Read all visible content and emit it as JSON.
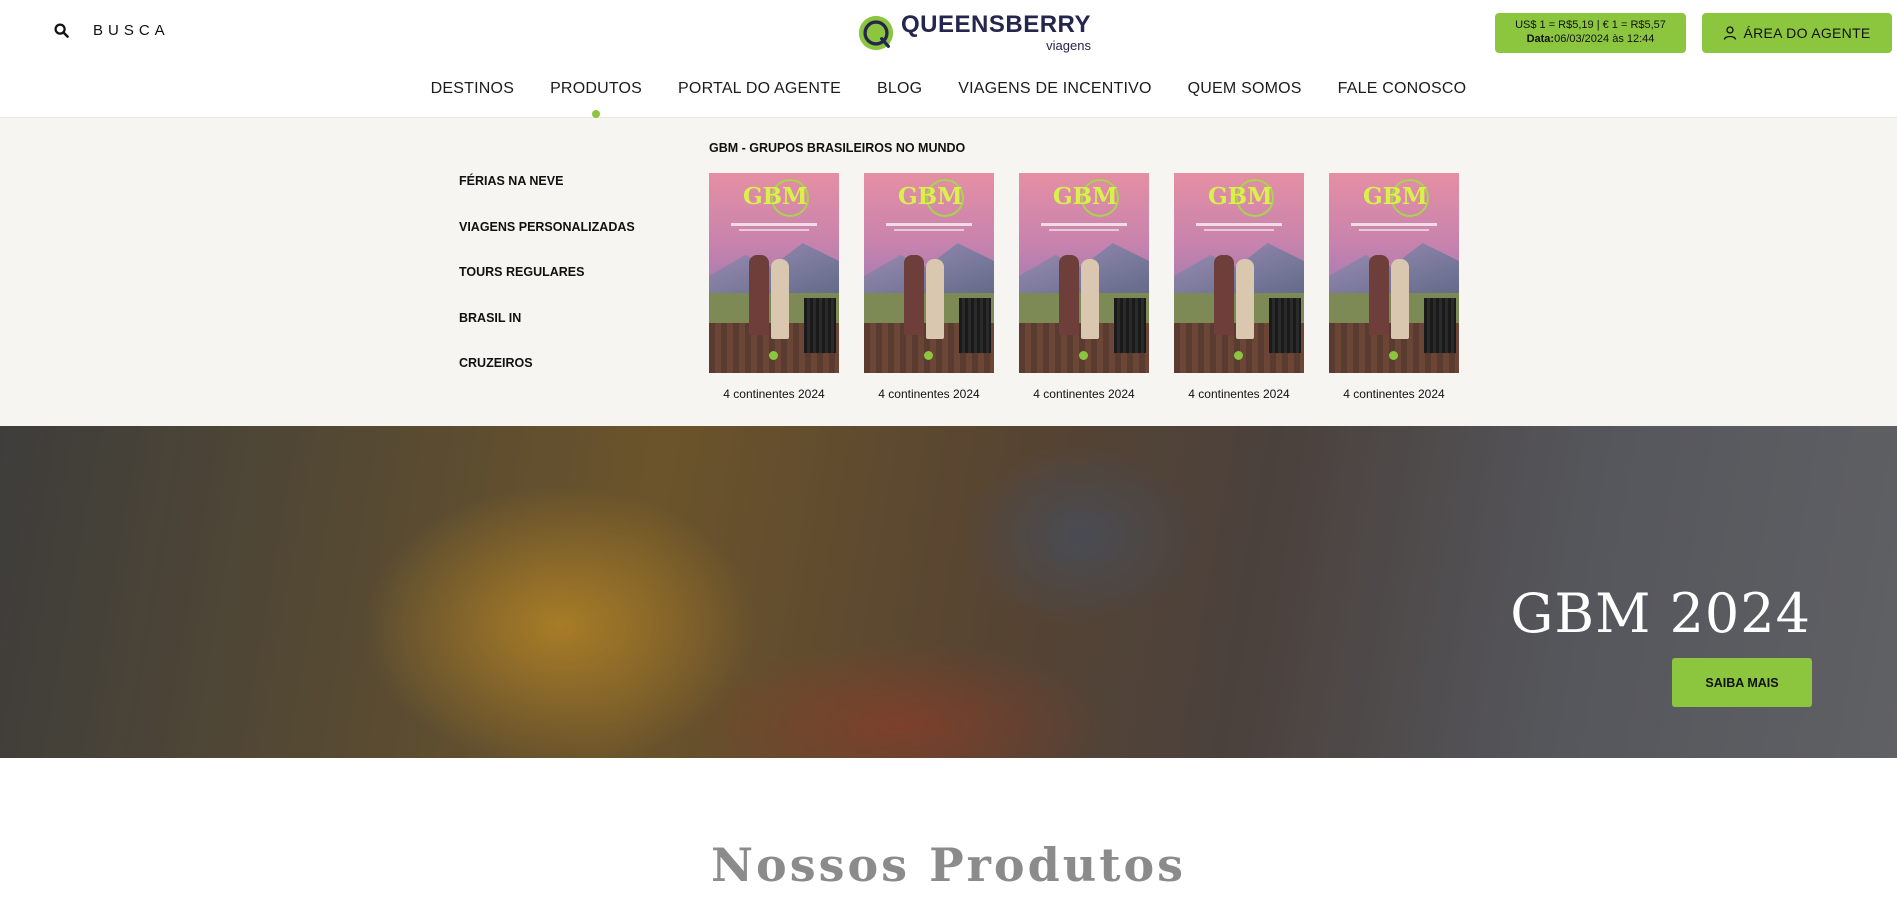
{
  "header": {
    "search_label": "BUSCA",
    "logo": {
      "name": "QUEENSBERRY",
      "sub": "viagens"
    },
    "exchange": {
      "rates": "US$ 1 = R$5,19 | € 1 = R$5,57",
      "date_label": "Data:",
      "date_value": "06/03/2024 às 12:44"
    },
    "agent_button": "ÁREA DO AGENTE",
    "nav": [
      {
        "label": "DESTINOS"
      },
      {
        "label": "PRODUTOS",
        "active": true
      },
      {
        "label": "PORTAL DO AGENTE"
      },
      {
        "label": "BLOG"
      },
      {
        "label": "VIAGENS DE INCENTIVO"
      },
      {
        "label": "QUEM SOMOS"
      },
      {
        "label": "FALE CONOSCO"
      }
    ]
  },
  "mega_menu": {
    "submenu": [
      "FÉRIAS NA NEVE",
      "VIAGENS PERSONALIZADAS",
      "TOURS REGULARES",
      "BRASIL IN",
      "CRUZEIROS"
    ],
    "catalog_title": "GBM - GRUPOS BRASILEIROS NO MUNDO",
    "catalogs": [
      {
        "caption": "4 continentes 2024",
        "cover_text": "GBM"
      },
      {
        "caption": "4 continentes 2024",
        "cover_text": "GBM"
      },
      {
        "caption": "4 continentes 2024",
        "cover_text": "GBM"
      },
      {
        "caption": "4 continentes 2024",
        "cover_text": "GBM"
      },
      {
        "caption": "4 continentes 2024",
        "cover_text": "GBM"
      }
    ]
  },
  "hero": {
    "title": "GBM 2024",
    "button": "SAIBA MAIS"
  },
  "section": {
    "title": "Nossos Produtos"
  },
  "colors": {
    "accent": "#8cc63f",
    "brand": "#25264d",
    "menu_bg": "#f6f5f2"
  },
  "icons": {
    "search": "search-icon",
    "user": "user-icon",
    "logo": "queensberry-logo-icon"
  }
}
